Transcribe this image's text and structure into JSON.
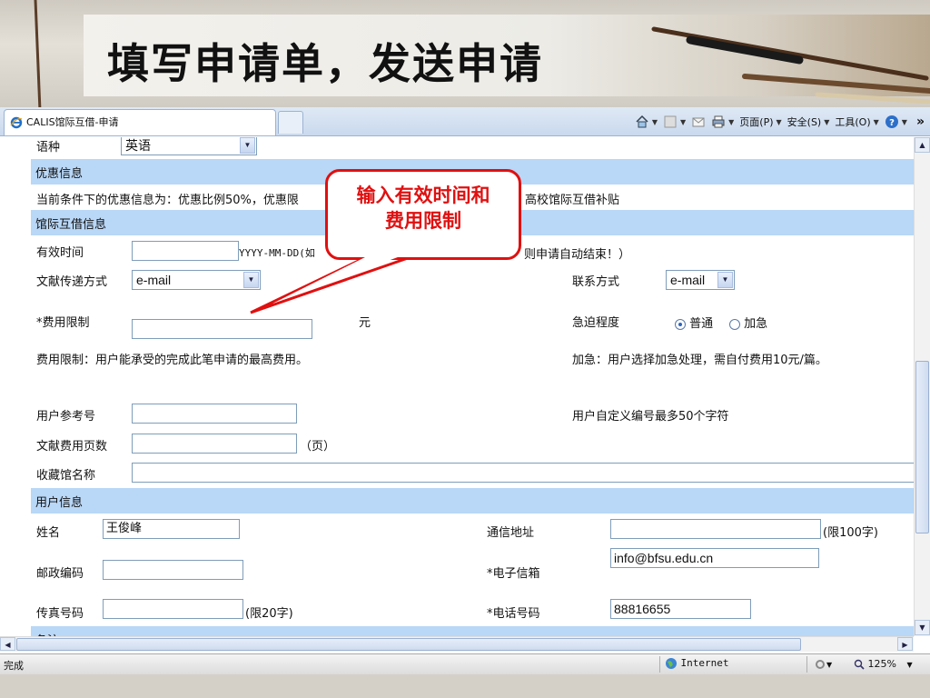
{
  "slide": {
    "title": "填写申请单，发送申请"
  },
  "browser": {
    "tab_title": "CALIS馆际互借-申请",
    "commands": {
      "page": "页面(P)",
      "safety": "安全(S)",
      "tools": "工具(O)",
      "more": "»"
    }
  },
  "form": {
    "language": {
      "label": "语种",
      "value": "英语"
    },
    "sections": {
      "discount": "优惠信息",
      "ill": "馆际互借信息",
      "user": "用户信息",
      "remarks": "备注"
    },
    "discount_text": "当前条件下的优惠信息为：优惠比例50%，优惠限",
    "discount_text_tail": "高校馆际互借补贴",
    "valid_time": {
      "label": "有效时间",
      "value": "",
      "hint": "YYYY-MM-DD(如",
      "hint_tail": "则申请自动结束！）"
    },
    "delivery": {
      "label": "文献传递方式",
      "value": "e-mail"
    },
    "contact": {
      "label": "联系方式",
      "value": "e-mail"
    },
    "fee_limit": {
      "label": "*费用限制",
      "value": "",
      "unit": "元"
    },
    "urgency": {
      "label": "急迫程度",
      "options": [
        "普通",
        "加急"
      ],
      "selected": "普通"
    },
    "fee_note": "费用限制：用户能承受的完成此笔申请的最高费用。",
    "urgent_note": "加急：用户选择加急处理，需自付费用10元/篇。",
    "ref_no": {
      "label": "用户参考号",
      "value": "",
      "hint": "用户自定义编号最多50个字符"
    },
    "pages": {
      "label": "文献费用页数",
      "value": "",
      "unit": "（页）"
    },
    "holding_lib": {
      "label": "收藏馆名称",
      "value": ""
    },
    "name": {
      "label": "姓名",
      "value": "王俊峰"
    },
    "address": {
      "label": "通信地址",
      "value": "",
      "hint": "(限100字)"
    },
    "postcode": {
      "label": "邮政编码",
      "value": ""
    },
    "email": {
      "label": "*电子信箱",
      "value": "info@bfsu.edu.cn"
    },
    "fax": {
      "label": "传真号码",
      "value": "",
      "hint": "(限20字)"
    },
    "phone": {
      "label": "*电话号码",
      "value": "88816655"
    }
  },
  "status": {
    "left": "完成",
    "zone": "Internet",
    "zoom": "125%"
  },
  "callout": {
    "line1": "输入有效时间和",
    "line2": "费用限制",
    "color": "#e01010"
  }
}
